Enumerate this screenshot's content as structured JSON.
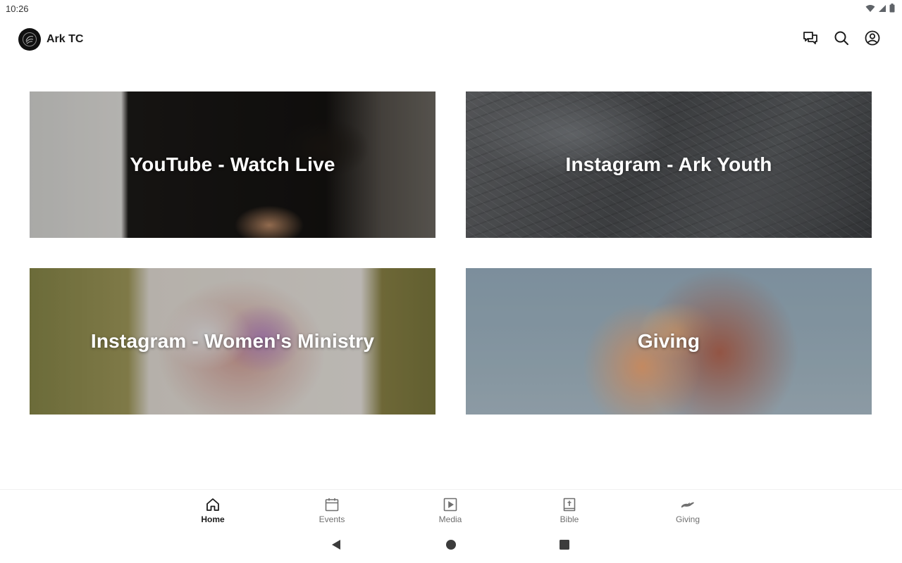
{
  "status_bar": {
    "time": "10:26",
    "icons": [
      "wifi-icon",
      "signal-icon",
      "battery-icon"
    ]
  },
  "app_bar": {
    "title": "Ark TC",
    "logo_icon": "church-logo-icon",
    "actions": [
      "messages-icon",
      "search-icon",
      "account-icon"
    ]
  },
  "cards": [
    {
      "title": "YouTube - Watch Live"
    },
    {
      "title": "Instagram - Ark Youth"
    },
    {
      "title": "Instagram - Women's Ministry"
    },
    {
      "title": "Giving"
    }
  ],
  "bottom_nav": {
    "items": [
      {
        "label": "Home",
        "icon": "home-icon",
        "active": true
      },
      {
        "label": "Events",
        "icon": "calendar-icon",
        "active": false
      },
      {
        "label": "Media",
        "icon": "play-icon",
        "active": false
      },
      {
        "label": "Bible",
        "icon": "bible-icon",
        "active": false
      },
      {
        "label": "Giving",
        "icon": "giving-hand-icon",
        "active": false
      }
    ]
  },
  "system_nav": [
    "back-icon",
    "home-circle-icon",
    "recents-icon"
  ],
  "colors": {
    "background": "#ffffff",
    "text_primary": "#1b1b1b",
    "text_secondary": "#6f6f6f",
    "card_text": "#ffffff"
  }
}
